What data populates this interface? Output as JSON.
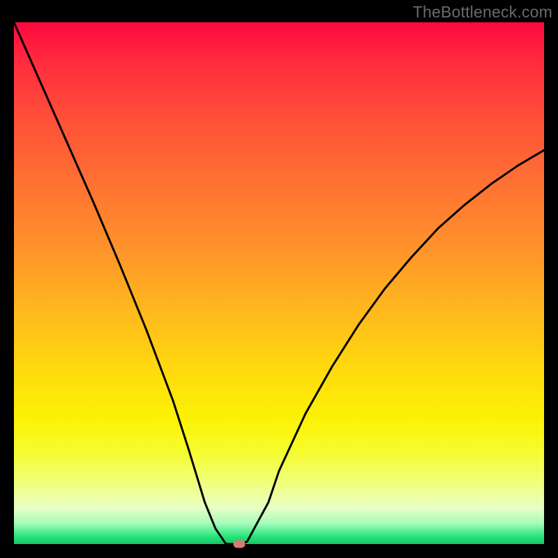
{
  "watermark": "TheBottleneck.com",
  "chart_data": {
    "type": "line",
    "title": "",
    "xlabel": "",
    "ylabel": "",
    "xlim": [
      0,
      100
    ],
    "ylim": [
      0,
      100
    ],
    "series": [
      {
        "name": "bottleneck-curve",
        "x": [
          0,
          5,
          10,
          15,
          20,
          25,
          30,
          33,
          36,
          38,
          40,
          41,
          43,
          44,
          48,
          50,
          55,
          60,
          65,
          70,
          75,
          80,
          85,
          90,
          95,
          100
        ],
        "values": [
          100,
          88.5,
          77,
          65.5,
          53.5,
          41,
          27.5,
          18,
          8,
          3,
          0,
          0,
          0,
          0.5,
          8,
          14,
          25,
          34,
          42,
          49,
          55,
          60.5,
          65,
          69,
          72.5,
          75.5
        ]
      }
    ],
    "marker": {
      "x": 42.5,
      "y": 0
    },
    "gradient_stops": [
      {
        "pct": 0,
        "color": "#fe093f"
      },
      {
        "pct": 50,
        "color": "#ffc217"
      },
      {
        "pct": 80,
        "color": "#f6fc2b"
      },
      {
        "pct": 100,
        "color": "#17c566"
      }
    ]
  }
}
